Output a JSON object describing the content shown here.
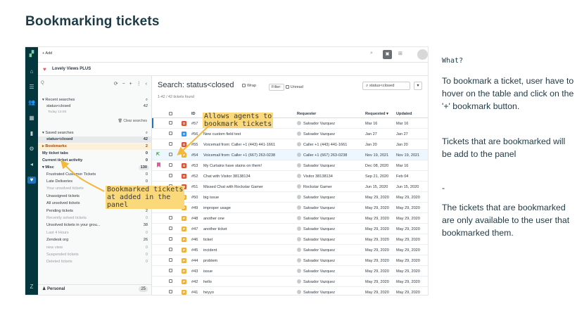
{
  "page_title": "Bookmarking tickets",
  "app": {
    "topbar": {
      "add_label": "+ Add"
    },
    "brand_name": "Lovely Views PLUS"
  },
  "sidebar": {
    "search_placeholder": "Q",
    "tool_icons": "⟳ − + ⋮ ‹",
    "recent_header": "Recent searches",
    "recent_item": {
      "label": "status<closed",
      "count": "42",
      "sub": "Today 13:06"
    },
    "clear_searches": "Clear searches",
    "saved_header": "Saved searches",
    "saved_item": {
      "label": "status<closed",
      "count": "42"
    },
    "bookmarks": {
      "label": "Bookmarks",
      "count": "2"
    },
    "my_ticket_tabs": {
      "label": "My ticket tabs",
      "count": "0"
    },
    "current_activity": {
      "label": "Current ticket activity",
      "count": "0"
    },
    "misc": {
      "label": "Misc",
      "count": "130"
    },
    "views": [
      {
        "label": "Frustrated Customer Tickets",
        "count": "0",
        "muted": false
      },
      {
        "label": "Late Deliveries",
        "count": "0",
        "muted": false
      },
      {
        "label": "Your unsolved tickets",
        "count": "0",
        "muted": true
      },
      {
        "label": "Unassigned tickets",
        "count": "18",
        "muted": false
      },
      {
        "label": "All unsolved tickets",
        "count": "42",
        "muted": false
      },
      {
        "label": "Pending tickets",
        "count": "2",
        "muted": false
      },
      {
        "label": "Recently solved tickets",
        "count": "0",
        "muted": true
      },
      {
        "label": "Unsolved tickets in your grou...",
        "count": "38",
        "muted": false
      },
      {
        "label": "Last 4 Hours",
        "count": "0",
        "muted": true
      },
      {
        "label": "Zendesk org",
        "count": "26",
        "muted": false
      },
      {
        "label": "new view",
        "count": "0",
        "muted": true
      },
      {
        "label": "Suspended tickets",
        "count": "0",
        "muted": true
      },
      {
        "label": "Deleted tickets",
        "count": "0",
        "muted": true
      }
    ],
    "personal": {
      "label": "Personal",
      "count": "25"
    }
  },
  "main": {
    "title": "Search: status<closed",
    "wrap_label": "Wrap",
    "filter_label": "Filter:",
    "unread_label": "Unread",
    "query": "status<closed",
    "found": "1-42 / 42 tickets found",
    "columns": {
      "id": "ID",
      "requester": "Requester",
      "requested": "Requested ▾",
      "updated": "Updated"
    },
    "rows": [
      {
        "status": "O",
        "status_color": "#e34f32",
        "id": "#57",
        "subject": "",
        "requester": "Salvador Vazquez",
        "requested": "Mar 16",
        "updated": "Mar 16",
        "marker": ""
      },
      {
        "status": "O",
        "status_color": "#3091ec",
        "id": "#56",
        "subject": "New custom field test",
        "requester": "Salvador Vazquez",
        "requested": "Jan 27",
        "updated": "Jan 27",
        "marker": ""
      },
      {
        "status": "O",
        "status_color": "#e34f32",
        "id": "#55",
        "subject": "Voicemail from: Caller +1 (443) 441-1661",
        "requester": "Caller +1 (443) 441-1661",
        "requested": "Jan 20",
        "updated": "Jan 20",
        "marker": ""
      },
      {
        "status": "P",
        "status_color": "#f0b232",
        "id": "#54",
        "subject": "Voicemail from: Caller +1 (667) 263-0238",
        "requester": "Caller +1 (667) 263-0238",
        "requested": "Nov 19, 2021",
        "updated": "Nov 19, 2021",
        "marker": "add"
      },
      {
        "status": "O",
        "status_color": "#e34f32",
        "id": "#53",
        "subject": "My Curtains have stains on them!",
        "requester": "Salvador Vazquez",
        "requested": "Dec 08, 2020",
        "updated": "Mar 16",
        "marker": "bookmark"
      },
      {
        "status": "O",
        "status_color": "#e34f32",
        "id": "#52",
        "subject": "Chat with Visitor 38138134",
        "requester": "Visitor 38138134",
        "requested": "Sep 21, 2020",
        "updated": "Feb 04",
        "marker": ""
      },
      {
        "status": "O",
        "status_color": "#e34f32",
        "id": "#51",
        "subject": "Missed Chat with Rockstar Gamer",
        "requester": "Rockstar Gamer",
        "requested": "Jun 15, 2020",
        "updated": "Jun 15, 2020",
        "marker": ""
      },
      {
        "status": "P",
        "status_color": "#f0b232",
        "id": "#50",
        "subject": "big issue",
        "requester": "Salvador Vazquez",
        "requested": "May 29, 2020",
        "updated": "May 29, 2020",
        "marker": ""
      },
      {
        "status": "P",
        "status_color": "#f0b232",
        "id": "#49",
        "subject": "improper usage",
        "requester": "Salvador Vazquez",
        "requested": "May 29, 2020",
        "updated": "May 29, 2020",
        "marker": ""
      },
      {
        "status": "P",
        "status_color": "#f0b232",
        "id": "#48",
        "subject": "another one",
        "requester": "Salvador Vazquez",
        "requested": "May 29, 2020",
        "updated": "May 29, 2020",
        "marker": ""
      },
      {
        "status": "P",
        "status_color": "#f0b232",
        "id": "#47",
        "subject": "another ticket",
        "requester": "Salvador Vazquez",
        "requested": "May 29, 2020",
        "updated": "May 29, 2020",
        "marker": ""
      },
      {
        "status": "P",
        "status_color": "#f0b232",
        "id": "#46",
        "subject": "ticket",
        "requester": "Salvador Vazquez",
        "requested": "May 29, 2020",
        "updated": "May 29, 2020",
        "marker": ""
      },
      {
        "status": "P",
        "status_color": "#f0b232",
        "id": "#45",
        "subject": "incident",
        "requester": "Salvador Vazquez",
        "requested": "May 29, 2020",
        "updated": "May 29, 2020",
        "marker": ""
      },
      {
        "status": "P",
        "status_color": "#f0b232",
        "id": "#44",
        "subject": "problem",
        "requester": "Salvador Vazquez",
        "requested": "May 29, 2020",
        "updated": "May 29, 2020",
        "marker": ""
      },
      {
        "status": "P",
        "status_color": "#f0b232",
        "id": "#43",
        "subject": "issue",
        "requester": "Salvador Vazquez",
        "requested": "May 29, 2020",
        "updated": "May 29, 2020",
        "marker": ""
      },
      {
        "status": "P",
        "status_color": "#f0b232",
        "id": "#42",
        "subject": "hello",
        "requester": "Salvador Vazquez",
        "requested": "May 29, 2020",
        "updated": "May 29, 2020",
        "marker": ""
      },
      {
        "status": "P",
        "status_color": "#f0b232",
        "id": "#41",
        "subject": "heyyo",
        "requester": "Salvador Vazquez",
        "requested": "May 29, 2020",
        "updated": "May 29, 2020",
        "marker": ""
      }
    ]
  },
  "annotations": {
    "allows": "Allows agents to\nbookmark tickets",
    "added": "Bookmarked tickets\nat added in the\npanel"
  },
  "info": {
    "what": "What?",
    "p1": "To bookmark a ticket, user have to hover on the table and click on the '+' bookmark button.",
    "p2": "Tickets that are bookmarked will be add to the panel",
    "dash": "-",
    "p3": "The tickets that are bookmarked are only available to the user that bookmarked them."
  },
  "colors": {
    "accent": "#fbd97a",
    "rail": "#03363d",
    "highlight_row": "#edf7ff",
    "bookmark": "#e35b9f"
  }
}
